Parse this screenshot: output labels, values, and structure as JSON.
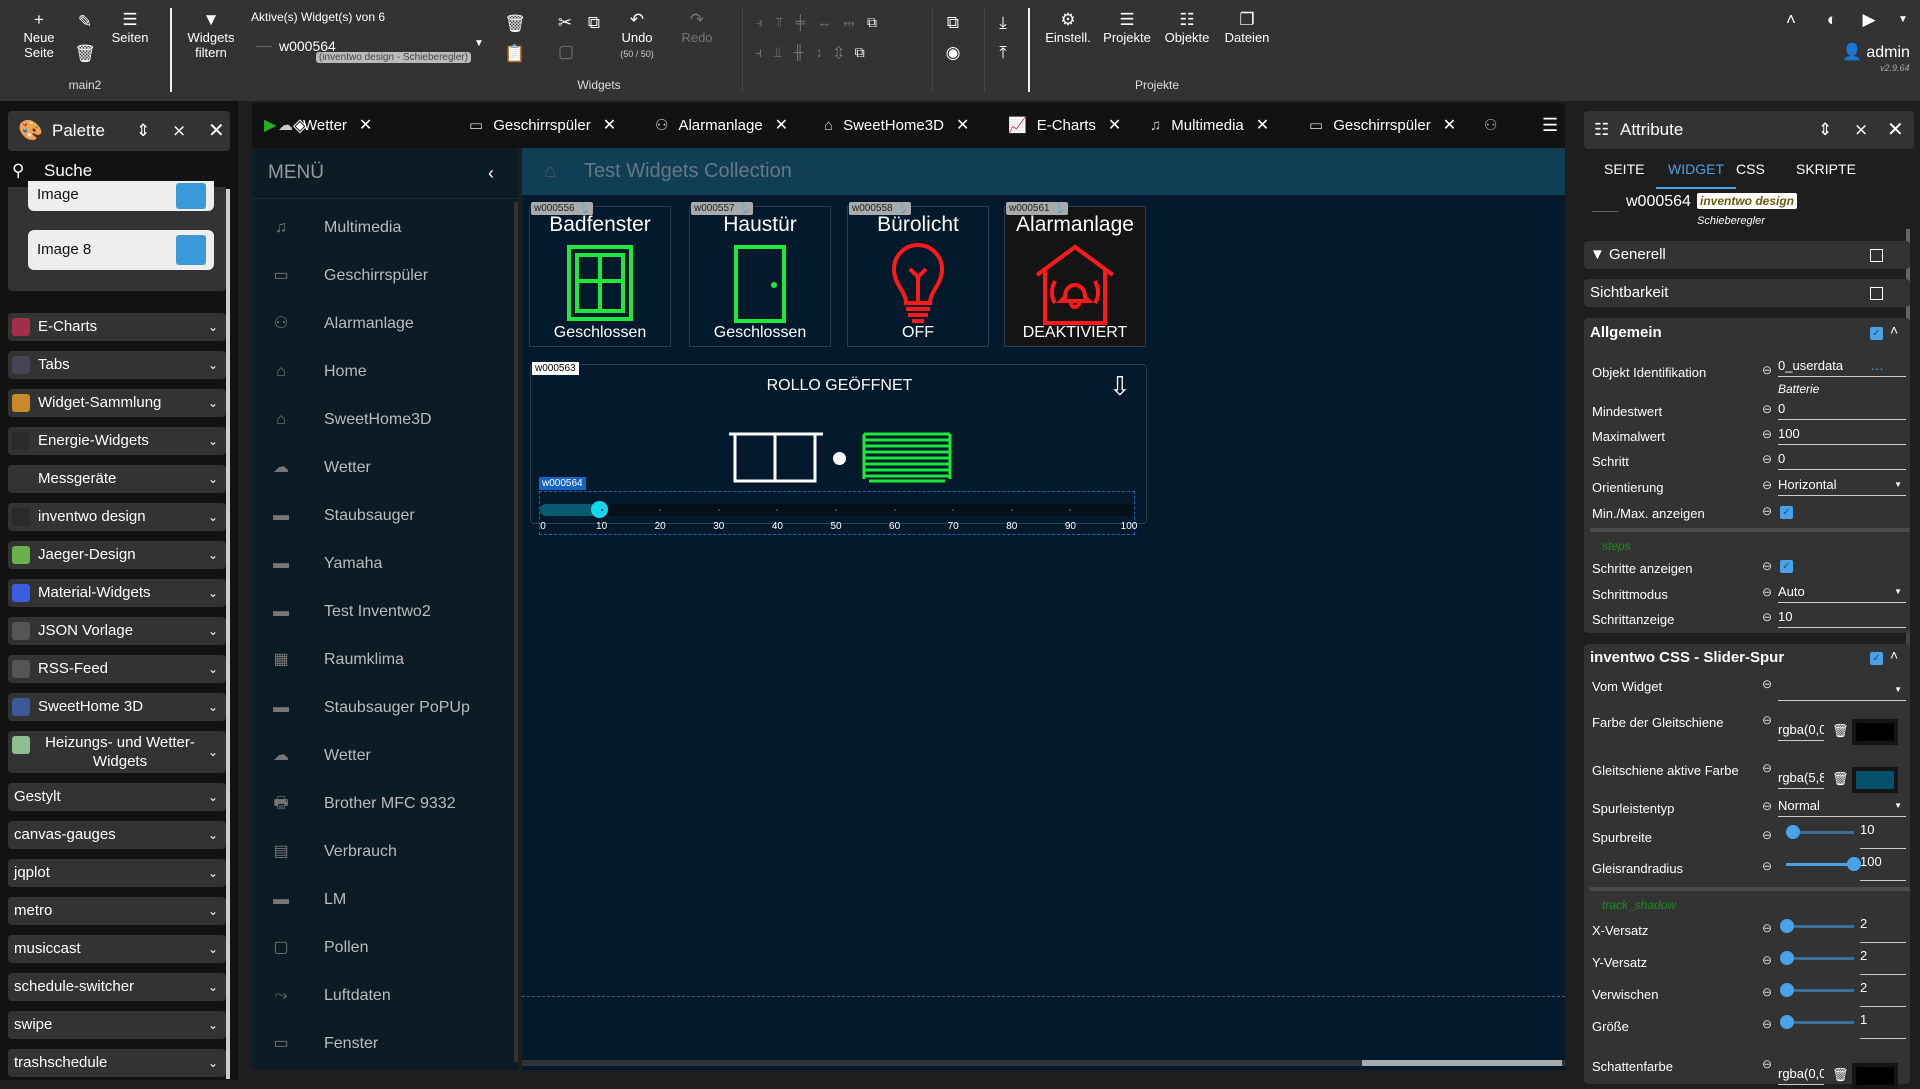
{
  "toolbar": {
    "new_page": "Neue\nSeite",
    "seiten": "Seiten",
    "page_name": "main2",
    "filter": "Widgets\nfiltern",
    "active_label": "Aktive(s) Widget(s) von 6",
    "selected_widget": "w000564",
    "selected_widget_type": "(inventwo design - Schieberegler)",
    "undo": "Undo",
    "undo_count": "(50 / 50)",
    "redo": "Redo",
    "widgets_group": "Widgets",
    "settings": "Einstell.",
    "projects": "Projekte",
    "objects": "Objekte",
    "files": "Dateien",
    "projects_group": "Projekte",
    "user": "admin",
    "version": "v2.9.64"
  },
  "tabs": [
    {
      "label": "Wetter",
      "icon": "weather-icon"
    },
    {
      "label": "Geschirrspüler",
      "icon": "dishwasher-icon"
    },
    {
      "label": "Alarmanlage",
      "icon": "alarm-icon"
    },
    {
      "label": "SweetHome3D",
      "icon": "home-icon"
    },
    {
      "label": "E-Charts",
      "icon": "chart-icon"
    },
    {
      "label": "Multimedia",
      "icon": "music-icon"
    },
    {
      "label": "Geschirrspüler",
      "icon": "dishwasher-icon"
    }
  ],
  "palette": {
    "title": "Palette",
    "search": "Suche",
    "images": [
      "Image",
      "Image 8"
    ],
    "categories": [
      {
        "label": "E-Charts",
        "color": "#a0304a"
      },
      {
        "label": "Tabs",
        "color": "#445"
      },
      {
        "label": "Widget-Sammlung",
        "color": "#c98a2a"
      },
      {
        "label": "Energie-Widgets",
        "color": "#2a2a2a"
      },
      {
        "label": "Messgeräte",
        "color": "#333"
      },
      {
        "label": "inventwo design",
        "color": "#2a2a2a"
      },
      {
        "label": "Jaeger-Design",
        "color": "#6ab04c"
      },
      {
        "label": "Material-Widgets",
        "color": "#3b5ee0"
      },
      {
        "label": "JSON Vorlage",
        "color": "#555"
      },
      {
        "label": "RSS-Feed",
        "color": "#555"
      },
      {
        "label": "SweetHome 3D",
        "color": "#3a5a9a"
      },
      {
        "label": "Heizungs- und Wetter-Widgets",
        "color": "#8fbf8f"
      },
      {
        "label": "Gestylt"
      },
      {
        "label": "canvas-gauges"
      },
      {
        "label": "jqplot"
      },
      {
        "label": "metro"
      },
      {
        "label": "musiccast"
      },
      {
        "label": "schedule-switcher"
      },
      {
        "label": "swipe"
      },
      {
        "label": "trashschedule"
      }
    ]
  },
  "menu": {
    "title": "MENÜ",
    "items": [
      "Multimedia",
      "Geschirrspüler",
      "Alarmanlage",
      "Home",
      "SweetHome3D",
      "Wetter",
      "Staubsauger",
      "Yamaha",
      "Test Inventwo2",
      "Raumklima",
      "Staubsauger PoPUp",
      "Wetter",
      "Brother MFC 9332",
      "Verbrauch",
      "LM",
      "Pollen",
      "Luftdaten",
      "Fenster"
    ]
  },
  "view": {
    "title": "Test Widgets Collection",
    "widgets": [
      {
        "id": "w000556",
        "title": "Badfenster",
        "state": "Geschlossen",
        "color": "#1ee83c"
      },
      {
        "id": "w000557",
        "title": "Haustür",
        "state": "Geschlossen",
        "color": "#1ee83c"
      },
      {
        "id": "w000558",
        "title": "Bürolicht",
        "state": "OFF",
        "color": "#ff1a1a"
      },
      {
        "id": "w000561",
        "title": "Alarmanlage",
        "state": "DEAKTIVIERT",
        "color": "#ff1a1a"
      }
    ],
    "rollo": {
      "id": "w000563",
      "title": "ROLLO GEÖFFNET",
      "slider_id": "w000564",
      "slider_value": 10,
      "min": 0,
      "max": 100,
      "ticks": [
        "0",
        "10",
        "20",
        "30",
        "40",
        "50",
        "60",
        "70",
        "80",
        "90",
        "100"
      ],
      "active_color": "#0a5a72",
      "knob_color": "#13d7ec"
    }
  },
  "attributes": {
    "title": "Attribute",
    "tabs": [
      "SEITE",
      "WIDGET",
      "CSS",
      "SKRIPTE"
    ],
    "active_tab": "WIDGET",
    "widget_id": "w000564",
    "badge": "inventwo design",
    "badge_sub": "Schieberegler",
    "generell": "Generell",
    "sichtbarkeit": "Sichtbarkeit",
    "allgemein": "Allgemein",
    "oid_label": "Objekt Identifikation",
    "oid_value": "0_userdata",
    "oid_name": "Batterie",
    "min_label": "Mindestwert",
    "min_value": "0",
    "max_label": "Maximalwert",
    "max_value": "100",
    "step_label": "Schritt",
    "step_value": "0",
    "orient_label": "Orientierung",
    "orient_value": "Horizontal",
    "minmax_label": "Min./Max. anzeigen",
    "minmax_checked": true,
    "steps_group": "steps",
    "showsteps_label": "Schritte anzeigen",
    "showsteps_checked": true,
    "stepmode_label": "Schrittmodus",
    "stepmode_value": "Auto",
    "stepdisplay_label": "Schrittanzeige",
    "stepdisplay_value": "10",
    "css_section": "inventwo CSS - Slider-Spur",
    "from_widget_label": "Vom Widget",
    "track_color_label": "Farbe der Gleitschiene",
    "track_color_value": "rgba(0,0",
    "track_color": "#000000",
    "active_color_label": "Gleitschiene aktive Farbe",
    "active_color_value": "rgba(5,8",
    "active_color": "#05506a",
    "tracktype_label": "Spurleistentyp",
    "tracktype_value": "Normal",
    "trackwidth_label": "Spurbreite",
    "trackwidth_value": "10",
    "trackwidth_frac": 0.1,
    "radius_label": "Gleisrandradius",
    "radius_value": "100",
    "radius_frac": 1.0,
    "shadow_group": "track_shadow",
    "x_label": "X-Versatz",
    "x_value": "2",
    "y_label": "Y-Versatz",
    "y_value": "2",
    "blur_label": "Verwischen",
    "blur_value": "2",
    "size_label": "Größe",
    "size_value": "1",
    "shadow_color_label": "Schattenfarbe",
    "shadow_color_value": "rgba(0,0",
    "shadow_color": "#000000"
  }
}
